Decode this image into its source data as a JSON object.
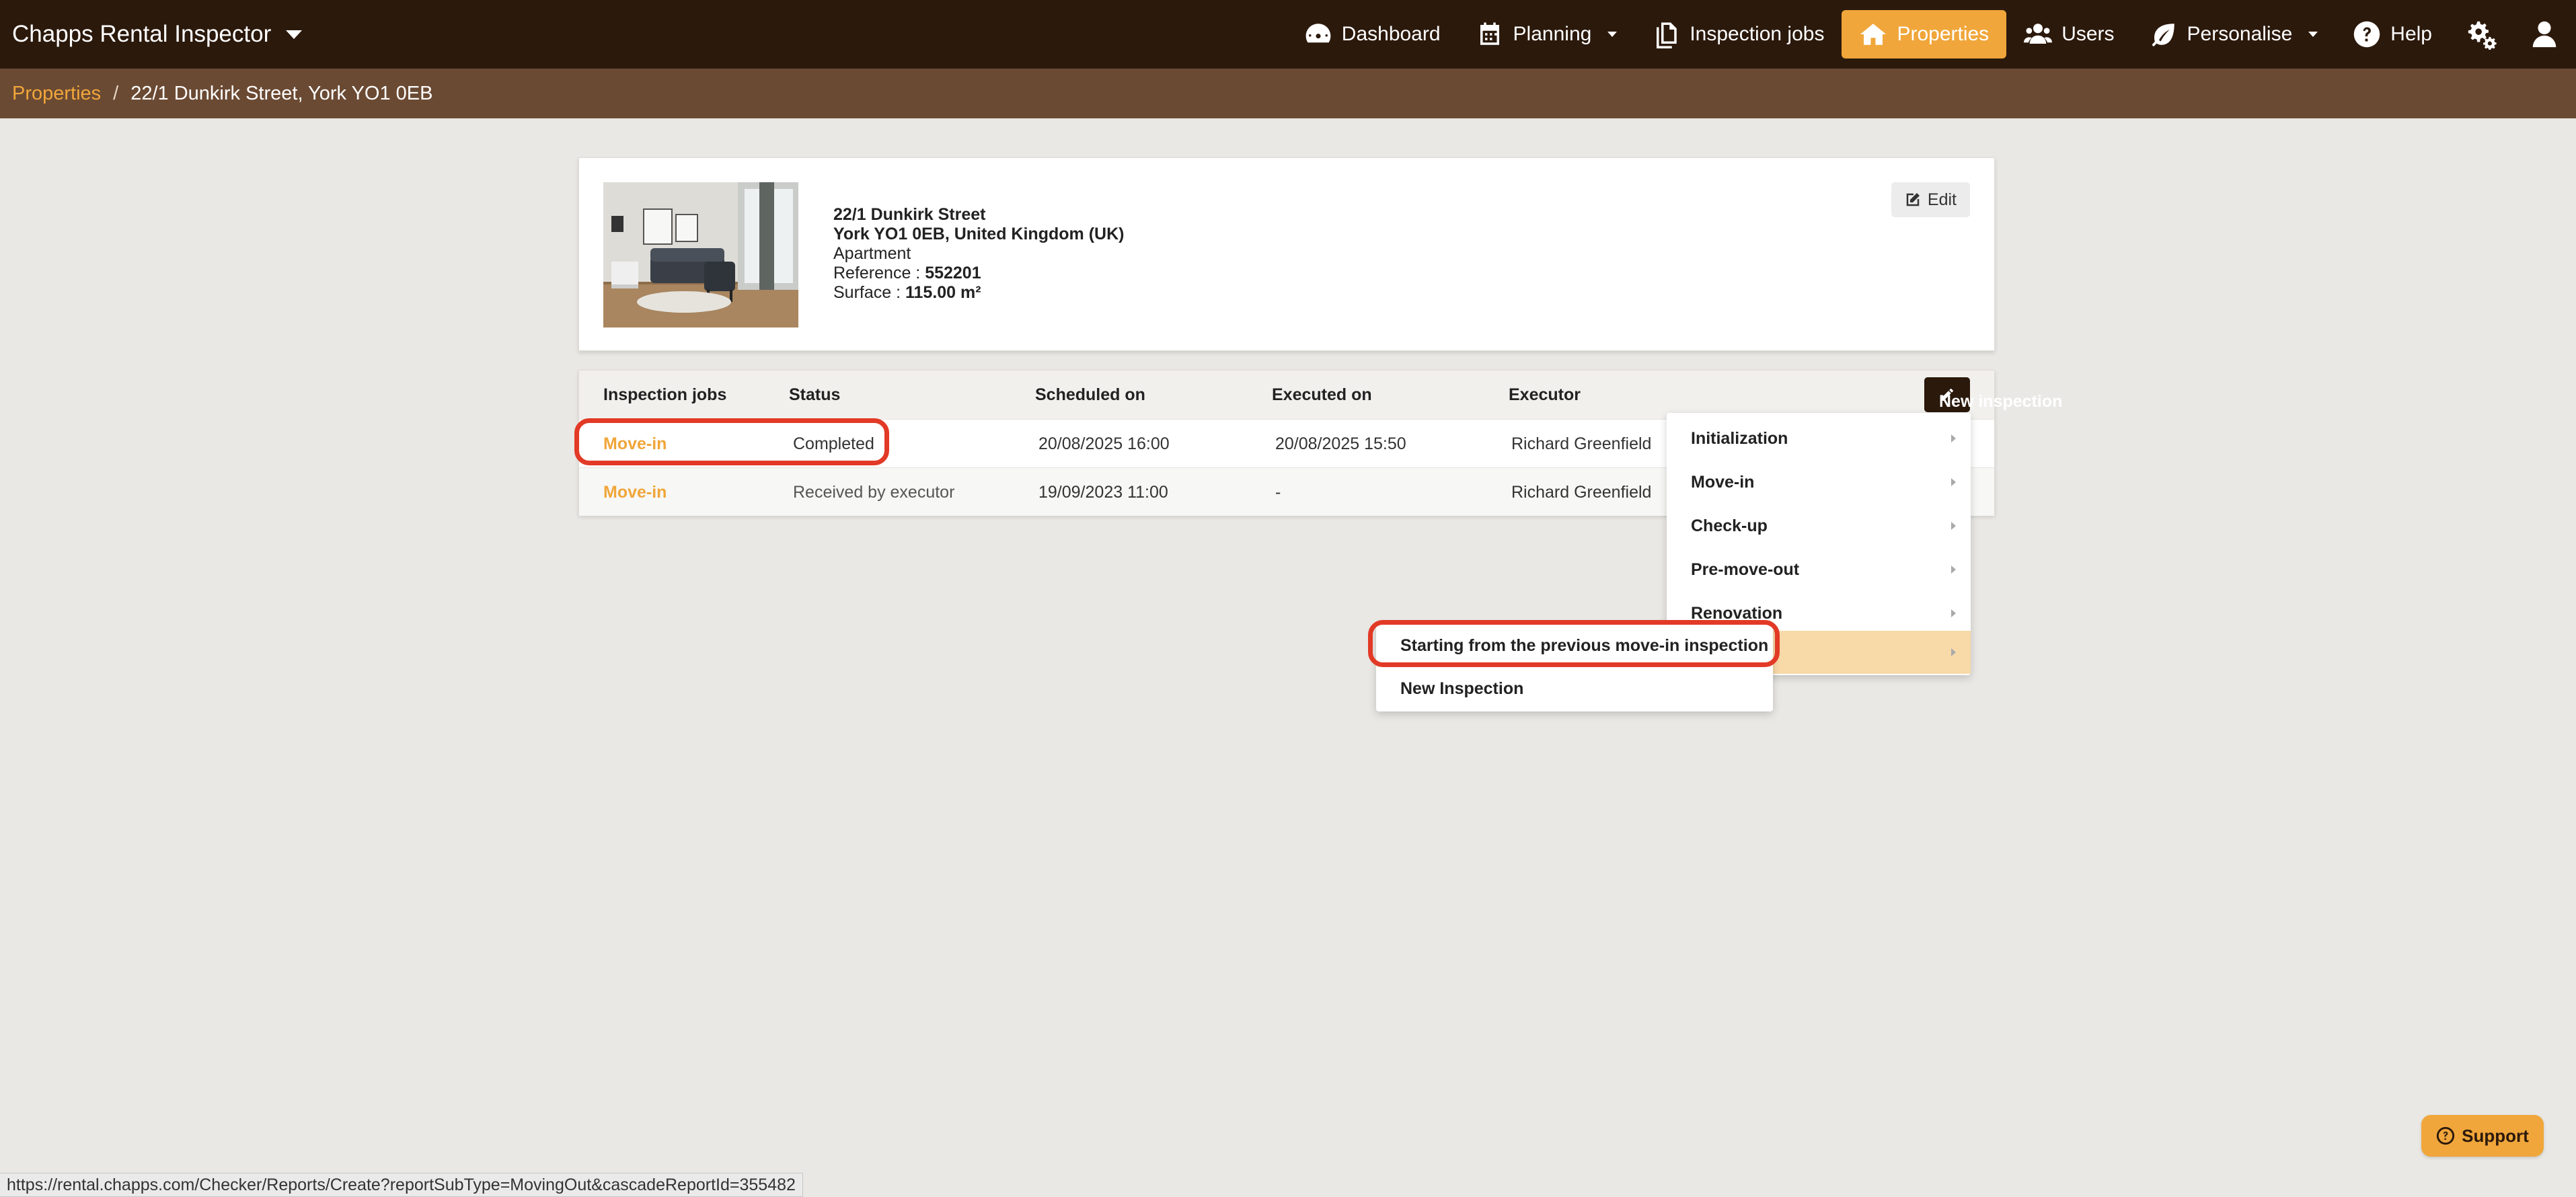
{
  "app": {
    "title": "Chapps Rental Inspector"
  },
  "nav": {
    "items": [
      {
        "label": "Dashboard",
        "icon": "dashboard-icon"
      },
      {
        "label": "Planning",
        "icon": "calendar-icon"
      },
      {
        "label": "Inspection jobs",
        "icon": "documents-icon"
      },
      {
        "label": "Properties",
        "icon": "home-icon"
      },
      {
        "label": "Users",
        "icon": "users-icon"
      },
      {
        "label": "Personalise",
        "icon": "leaf-icon"
      },
      {
        "label": "Help",
        "icon": "help-icon"
      }
    ]
  },
  "breadcrumb": {
    "root": "Properties",
    "separator": "/",
    "current": "22/1 Dunkirk Street, York YO1 0EB"
  },
  "property": {
    "street": "22/1 Dunkirk Street",
    "city_line": "York YO1 0EB, United Kingdom (UK)",
    "type": "Apartment",
    "reference_label": "Reference : ",
    "reference": "552201",
    "surface_label": "Surface : ",
    "surface": "115.00 m²",
    "edit_label": "Edit"
  },
  "jobs": {
    "headers": [
      "Inspection jobs",
      "Status",
      "Scheduled on",
      "Executed on",
      "Executor"
    ],
    "new_button": "New inspection",
    "rows": [
      {
        "type": "Move-in",
        "status": "Completed",
        "scheduled": "20/08/2025 16:00",
        "executed": "20/08/2025 15:50",
        "executor": "Richard Greenfield"
      },
      {
        "type": "Move-in",
        "status": "Received by executor",
        "scheduled": "19/09/2023 11:00",
        "executed": "-",
        "executor": "Richard Greenfield"
      }
    ]
  },
  "new_inspection_menu": {
    "items": [
      "Initialization",
      "Move-in",
      "Check-up",
      "Pre-move-out",
      "Renovation",
      ""
    ]
  },
  "submenu": {
    "items": [
      "Starting from the previous move-in inspection",
      "New Inspection"
    ]
  },
  "status_url": "https://rental.chapps.com/Checker/Reports/Create?reportSubType=MovingOut&cascadeReportId=355482",
  "support": {
    "label": "Support"
  },
  "colors": {
    "navbar": "#2b190c",
    "accent": "#f0a63a",
    "breadcrumb_bar": "#6b4a33",
    "annotation": "#e23a26",
    "menu_highlight": "#f8d9a8"
  }
}
